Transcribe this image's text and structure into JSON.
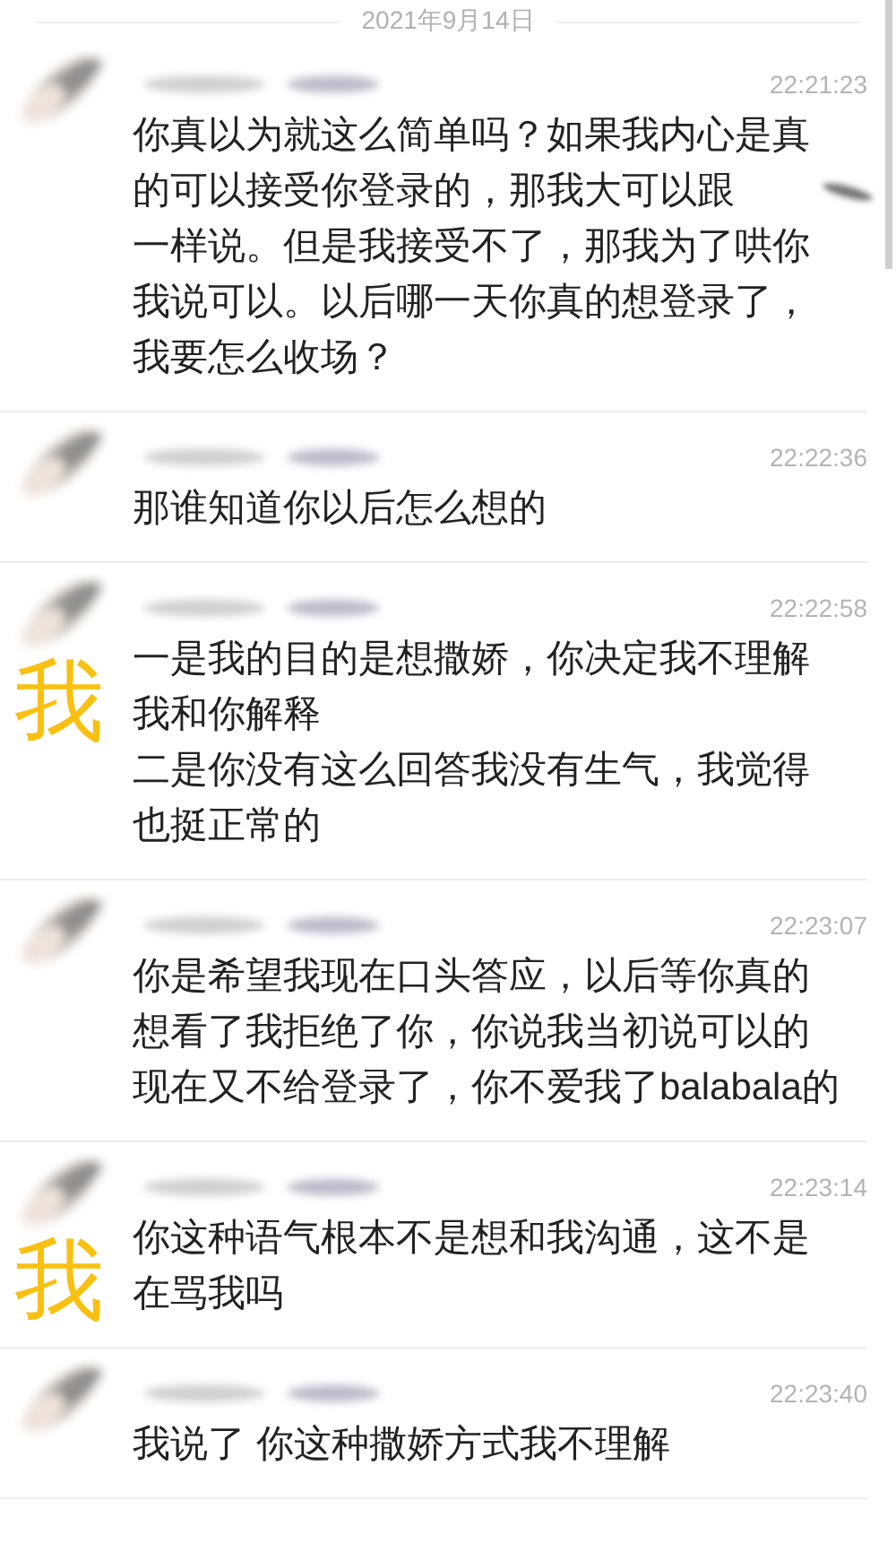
{
  "date_separator": "2021年9月14日",
  "messages": [
    {
      "time": "22:21:23",
      "paragraphs": [
        "你真以为就这么简单吗？如果我内心是真的可以接受你登录的，那我大可以跟",
        "一样说。但是我接受不了，那我为了哄你我说可以。以后哪一天你真的想登录了，我要怎么收场？"
      ]
    },
    {
      "time": "22:22:36",
      "paragraphs": [
        "那谁知道你以后怎么想的"
      ]
    },
    {
      "time": "22:22:58",
      "paragraphs": [
        "一是我的目的是想撒娇，你决定我不理解我和你解释",
        "二是你没有这么回答我没有生气，我觉得也挺正常的"
      ],
      "label": "我"
    },
    {
      "time": "22:23:07",
      "paragraphs": [
        "你是希望我现在口头答应，以后等你真的想看了我拒绝了你，你说我当初说可以的现在又不给登录了，你不爱我了balabala的"
      ]
    },
    {
      "time": "22:23:14",
      "paragraphs": [
        "你这种语气根本不是想和我沟通，这不是在骂我吗"
      ],
      "label": "我"
    },
    {
      "time": "22:23:40",
      "paragraphs": [
        "我说了 你这种撒娇方式我不理解"
      ]
    }
  ]
}
